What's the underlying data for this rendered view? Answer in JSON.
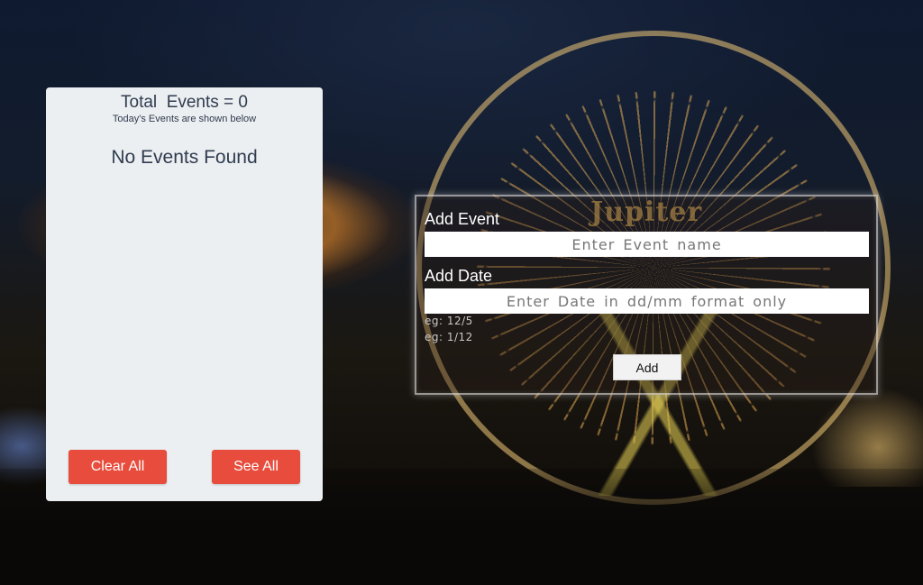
{
  "events_panel": {
    "total_label": "Total  Events = 0",
    "subtitle": "Today's Events are shown below",
    "empty_message": "No Events Found",
    "clear_all_label": "Clear All",
    "see_all_label": "See All"
  },
  "add_form": {
    "event_label": "Add Event",
    "event_placeholder": "Enter Event name",
    "date_label": "Add Date",
    "date_placeholder": "Enter Date in dd/mm format only",
    "examples": [
      "eg: 12/5",
      "eg: 1/12"
    ],
    "add_button_label": "Add"
  },
  "background": {
    "sign_text": "Jupiter"
  },
  "colors": {
    "accent_red": "#e74c3c",
    "card_bg": "#eceff1",
    "text_dark": "#2f3b4f"
  }
}
